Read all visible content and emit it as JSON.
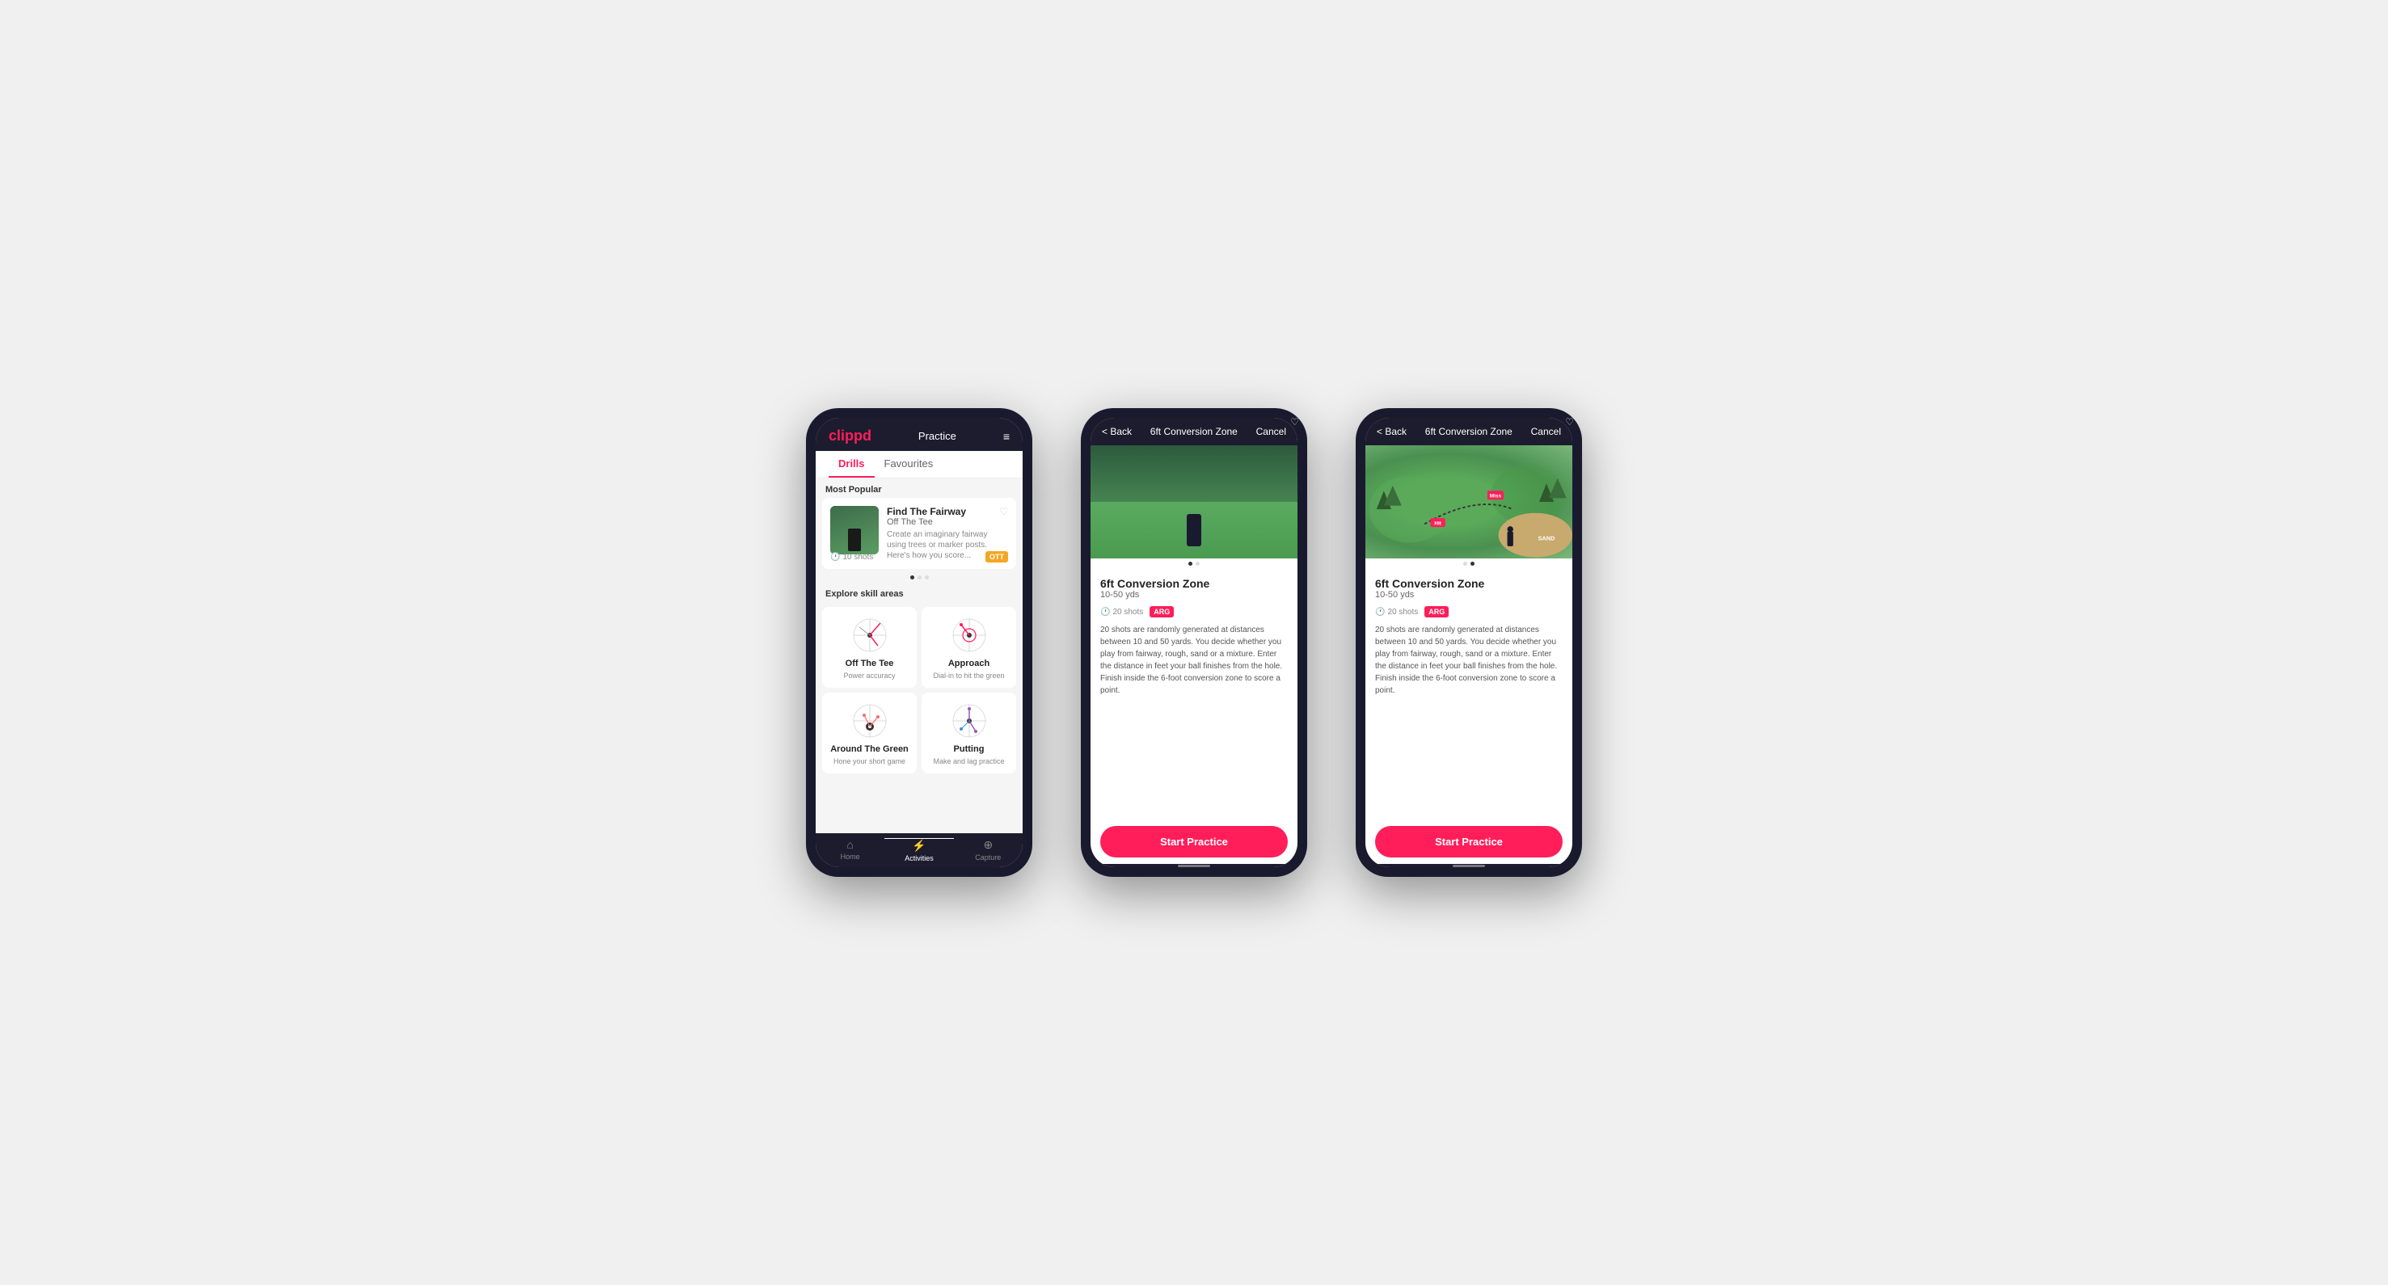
{
  "phone1": {
    "header": {
      "logo": "clippd",
      "title": "Practice",
      "menu_icon": "≡"
    },
    "tabs": [
      "Drills",
      "Favourites"
    ],
    "active_tab": "Drills",
    "most_popular_label": "Most Popular",
    "featured_drill": {
      "title": "Find The Fairway",
      "subtitle": "Off The Tee",
      "description": "Create an imaginary fairway using trees or marker posts. Here's how you score...",
      "shots": "10 shots",
      "badge": "OTT"
    },
    "explore_label": "Explore skill areas",
    "skill_areas": [
      {
        "name": "Off The Tee",
        "desc": "Power accuracy"
      },
      {
        "name": "Approach",
        "desc": "Dial-in to hit the green"
      },
      {
        "name": "Around The Green",
        "desc": "Hone your short game"
      },
      {
        "name": "Putting",
        "desc": "Make and lag practice"
      }
    ],
    "nav": [
      {
        "label": "Home",
        "icon": "⌂"
      },
      {
        "label": "Activities",
        "icon": "⚡"
      },
      {
        "label": "Capture",
        "icon": "⊕"
      }
    ],
    "active_nav": "Activities"
  },
  "phone2": {
    "header": {
      "back": "< Back",
      "title": "6ft Conversion Zone",
      "cancel": "Cancel"
    },
    "drill_title": "6ft Conversion Zone",
    "drill_range": "10-50 yds",
    "shots": "20 shots",
    "badge": "ARG",
    "description": "20 shots are randomly generated at distances between 10 and 50 yards. You decide whether you play from fairway, rough, sand or a mixture. Enter the distance in feet your ball finishes from the hole. Finish inside the 6-foot conversion zone to score a point.",
    "start_button": "Start Practice"
  },
  "phone3": {
    "header": {
      "back": "< Back",
      "title": "6ft Conversion Zone",
      "cancel": "Cancel"
    },
    "drill_title": "6ft Conversion Zone",
    "drill_range": "10-50 yds",
    "shots": "20 shots",
    "badge": "ARG",
    "description": "20 shots are randomly generated at distances between 10 and 50 yards. You decide whether you play from fairway, rough, sand or a mixture. Enter the distance in feet your ball finishes from the hole. Finish inside the 6-foot conversion zone to score a point.",
    "start_button": "Start Practice",
    "map_labels": {
      "miss": "Miss",
      "hit": "Hit",
      "sand": "SAND"
    }
  }
}
